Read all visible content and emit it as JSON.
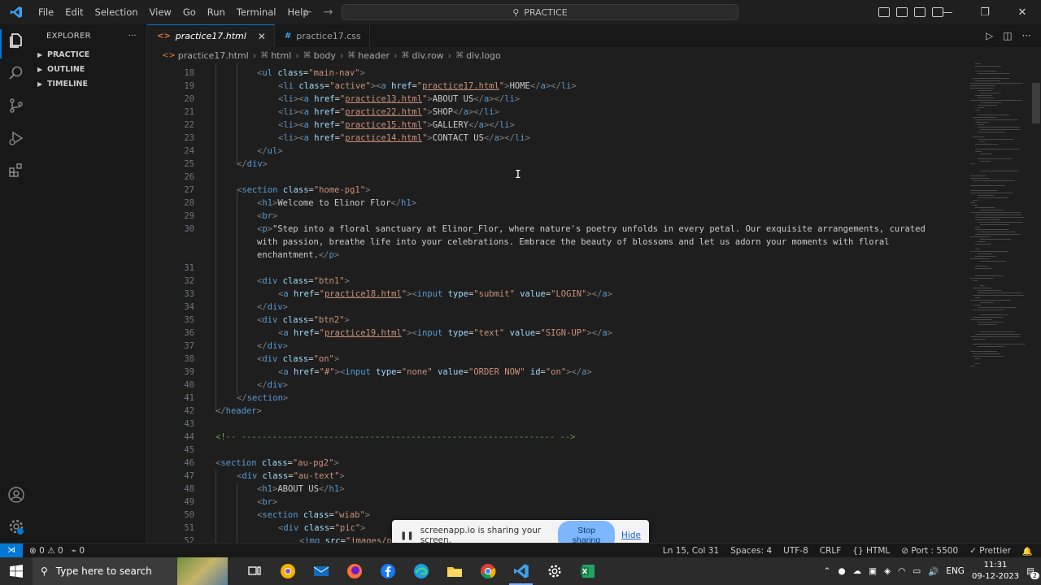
{
  "titlebar": {
    "menu": [
      "File",
      "Edit",
      "Selection",
      "View",
      "Go",
      "Run",
      "Terminal",
      "Help"
    ],
    "search_text": "PRACTICE"
  },
  "sidebar": {
    "title": "EXPLORER",
    "more": "···",
    "items": [
      "PRACTICE",
      "OUTLINE",
      "TIMELINE"
    ]
  },
  "tabs": [
    {
      "label": "practice17.html",
      "icon": "html-file-icon"
    },
    {
      "label": "practice17.css",
      "icon": "css-file-icon"
    }
  ],
  "breadcrumb": [
    "practice17.html",
    "html",
    "body",
    "header",
    "div.row",
    "div.logo"
  ],
  "lines": {
    "n": [
      "18",
      "19",
      "20",
      "21",
      "22",
      "23",
      "24",
      "25",
      "26",
      "27",
      "28",
      "29",
      "30",
      "",
      "",
      "31",
      "32",
      "33",
      "34",
      "35",
      "36",
      "37",
      "38",
      "39",
      "40",
      "41",
      "42",
      "43",
      "44",
      "45",
      "46",
      "47",
      "48",
      "49",
      "50",
      "51",
      "52"
    ]
  },
  "share": {
    "message": "screenapp.io is sharing your screen.",
    "stop": "Stop sharing",
    "hide": "Hide"
  },
  "status": {
    "errors": "0",
    "warnings": "0",
    "ports": "0",
    "position": "Ln 15, Col 31",
    "spaces": "Spaces: 4",
    "encoding": "UTF-8",
    "eol": "CRLF",
    "language": "HTML",
    "port": "Port : 5500",
    "formatter": "Prettier"
  },
  "taskbar": {
    "search_placeholder": "Type here to search",
    "lang": "ENG",
    "time": "11:31",
    "date": "09-12-2023",
    "notifications": "2"
  },
  "colors": {
    "accent": "#0078d4",
    "tag": "#569cd6",
    "attr": "#9cdcfe",
    "string": "#ce9178",
    "comment": "#6a9955"
  }
}
